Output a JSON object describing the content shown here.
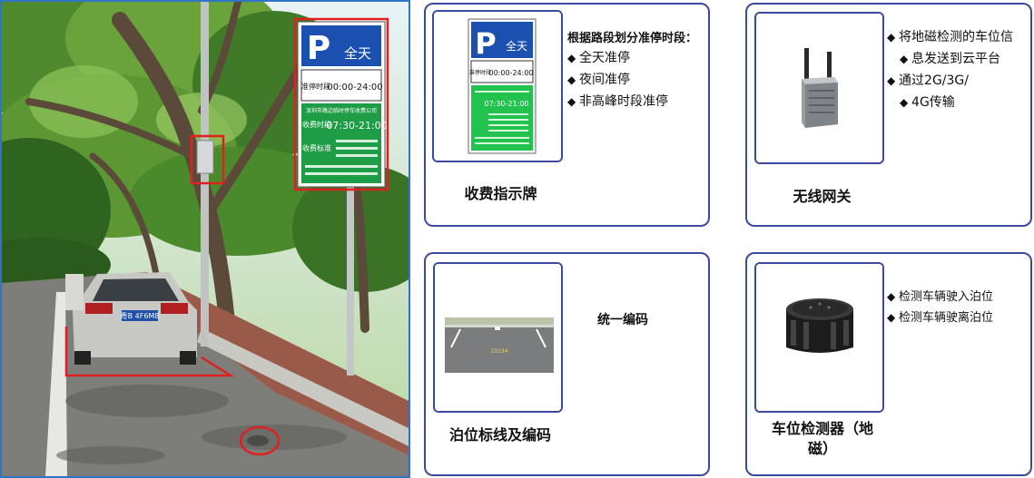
{
  "photo": {
    "sign": {
      "p_letter": "P",
      "p_word": "全天",
      "row1_label": "准停时段",
      "row1_value": "00:00-24:00",
      "company": "深圳市路边临时停车收费公司",
      "row2_label": "收费时段",
      "row2_value": "07:30-21:00",
      "row3_label": "收费标准"
    },
    "plate": "粤B 4F6M8"
  },
  "cards": {
    "sign": {
      "title": "收费指示牌",
      "heading": "根据路段划分准停时段：",
      "bullets": [
        "全天准停",
        "夜间准停",
        "非高峰时段准停"
      ],
      "mini_sign": {
        "p_letter": "P",
        "p_word": "全天",
        "row1_label": "准停时段",
        "row1_value": "00:00-24:00",
        "row2_value": "07:30-21:00"
      }
    },
    "gateway": {
      "title": "无线网关",
      "bullets": [
        "将地磁检测的车位信",
        "息发送到云平台",
        "通过2G/3G/",
        "4G传输"
      ]
    },
    "parking": {
      "title": "泊位标线及编码",
      "code_label": "统一编码",
      "slot_code": "10134"
    },
    "detector": {
      "title_line1": "车位检测器（地",
      "title_line2": "磁）",
      "bullets": [
        "检测车辆驶入泊位",
        "检测车辆驶离泊位"
      ]
    }
  }
}
